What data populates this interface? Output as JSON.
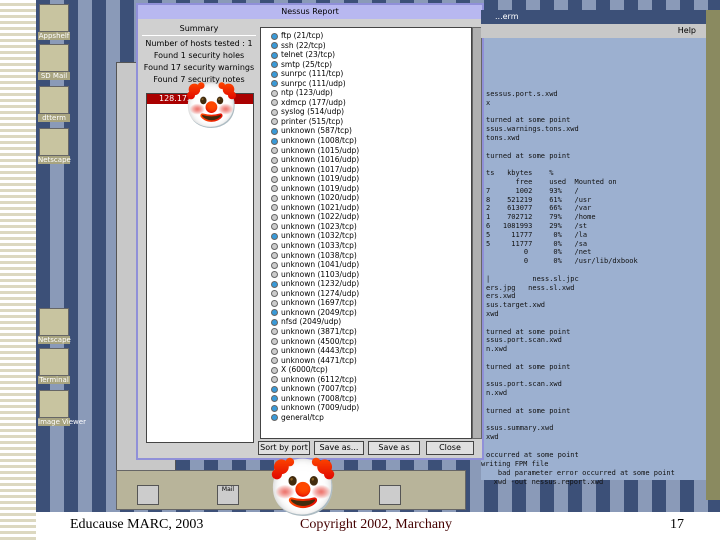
{
  "desktop_icons": [
    {
      "label": "Appshelf"
    },
    {
      "label": "SD Mail"
    },
    {
      "label": "dtterm"
    },
    {
      "label": "Netscape"
    },
    {
      "label": "Netscape"
    },
    {
      "label": "Terminal"
    },
    {
      "label": "Image Viewer"
    }
  ],
  "terminal": {
    "title": "...erm",
    "menu_help": "Help",
    "lines": [
      "sessus.port.s.xwd",
      "x",
      "",
      "turned at some point",
      "ssus.warnings.tons.xwd",
      "tons.xwd",
      "",
      "turned at some point",
      "",
      "ts   kbytes    %",
      "       free    used  Mounted on",
      "7      1002    93%   /",
      "8    521219    61%   /usr",
      "2    613077    66%   /var",
      "1    702712    79%   /home",
      "6   1081993    29%   /st",
      "5     11777     0%   /la",
      "5     11777     0%   /sa",
      "         0      0%   /net",
      "         0      0%   /usr/lib/dxbook",
      "",
      "|          ness.sl.jpc",
      "ers.jpg   ness.sl.xwd",
      "ers.xwd",
      "sus.target.xwd",
      "xwd",
      "",
      "turned at some point",
      "ssus.port.scan.xwd",
      "n.xwd",
      "",
      "turned at some point",
      "",
      "ssus.port.scan.xwd",
      "n.xwd",
      "",
      "turned at some point",
      "",
      "ssus.summary.xwd",
      "xwd",
      "",
      "occurred at some point"
    ],
    "bottom_lines": [
      "writing FPM file",
      "    bad parameter error occurred at some point",
      "   xwd -out nessus.report.xwd"
    ]
  },
  "nessus": {
    "title": "Nessus Report",
    "summary_title": "Summary",
    "hosts_tested": "Number of hosts tested : 1",
    "holes": "Found 1 security holes",
    "warnings": "Found 17 security warnings",
    "notes": "Found 7 security notes",
    "host": "128.173...",
    "ports": [
      {
        "name": "ftp (21/tcp)",
        "state": "info"
      },
      {
        "name": "ssh (22/tcp)",
        "state": "info"
      },
      {
        "name": "telnet (23/tcp)",
        "state": "info"
      },
      {
        "name": "smtp (25/tcp)",
        "state": "info"
      },
      {
        "name": "sunrpc (111/tcp)",
        "state": "info"
      },
      {
        "name": "sunrpc (111/udp)",
        "state": "info"
      },
      {
        "name": "ntp (123/udp)",
        "state": "none"
      },
      {
        "name": "xdmcp (177/udp)",
        "state": "none"
      },
      {
        "name": "syslog (514/udp)",
        "state": "none"
      },
      {
        "name": "printer (515/tcp)",
        "state": "none"
      },
      {
        "name": "unknown (587/tcp)",
        "state": "info"
      },
      {
        "name": "unknown (1008/tcp)",
        "state": "info"
      },
      {
        "name": "unknown (1015/udp)",
        "state": "none"
      },
      {
        "name": "unknown (1016/udp)",
        "state": "none"
      },
      {
        "name": "unknown (1017/udp)",
        "state": "none"
      },
      {
        "name": "unknown (1019/udp)",
        "state": "none"
      },
      {
        "name": "unknown (1019/udp)",
        "state": "none"
      },
      {
        "name": "unknown (1020/udp)",
        "state": "none"
      },
      {
        "name": "unknown (1021/udp)",
        "state": "none"
      },
      {
        "name": "unknown (1022/udp)",
        "state": "none"
      },
      {
        "name": "unknown (1023/tcp)",
        "state": "none"
      },
      {
        "name": "unknown (1032/tcp)",
        "state": "info"
      },
      {
        "name": "unknown (1033/tcp)",
        "state": "none"
      },
      {
        "name": "unknown (1038/tcp)",
        "state": "none"
      },
      {
        "name": "unknown (1041/udp)",
        "state": "none"
      },
      {
        "name": "unknown (1103/udp)",
        "state": "none"
      },
      {
        "name": "unknown (1232/udp)",
        "state": "info"
      },
      {
        "name": "unknown (1274/udp)",
        "state": "none"
      },
      {
        "name": "unknown (1697/tcp)",
        "state": "none"
      },
      {
        "name": "unknown (2049/tcp)",
        "state": "info"
      },
      {
        "name": "nfsd (2049/udp)",
        "state": "info"
      },
      {
        "name": "unknown (3871/tcp)",
        "state": "none"
      },
      {
        "name": "unknown (4500/tcp)",
        "state": "none"
      },
      {
        "name": "unknown (4443/tcp)",
        "state": "none"
      },
      {
        "name": "unknown (4471/tcp)",
        "state": "none"
      },
      {
        "name": "X (6000/tcp)",
        "state": "none"
      },
      {
        "name": "unknown (6112/tcp)",
        "state": "none"
      },
      {
        "name": "unknown (7007/tcp)",
        "state": "info"
      },
      {
        "name": "unknown (7008/tcp)",
        "state": "info"
      },
      {
        "name": "unknown (7009/udp)",
        "state": "info"
      },
      {
        "name": "general/tcp",
        "state": "info"
      }
    ],
    "buttons": {
      "sort": "Sort by port",
      "save": "Save as...",
      "format": "Save as",
      "close": "Close"
    }
  },
  "panel": {
    "mail_label": "Mail"
  },
  "footer": {
    "left": "Educause MARC, 2003",
    "center": "Copyright 2002, Marchany",
    "page": "17"
  },
  "colors": {
    "info_dot": "#3a9ad8",
    "none_dot": "#cccccc",
    "host_selected": "#aa0000"
  }
}
